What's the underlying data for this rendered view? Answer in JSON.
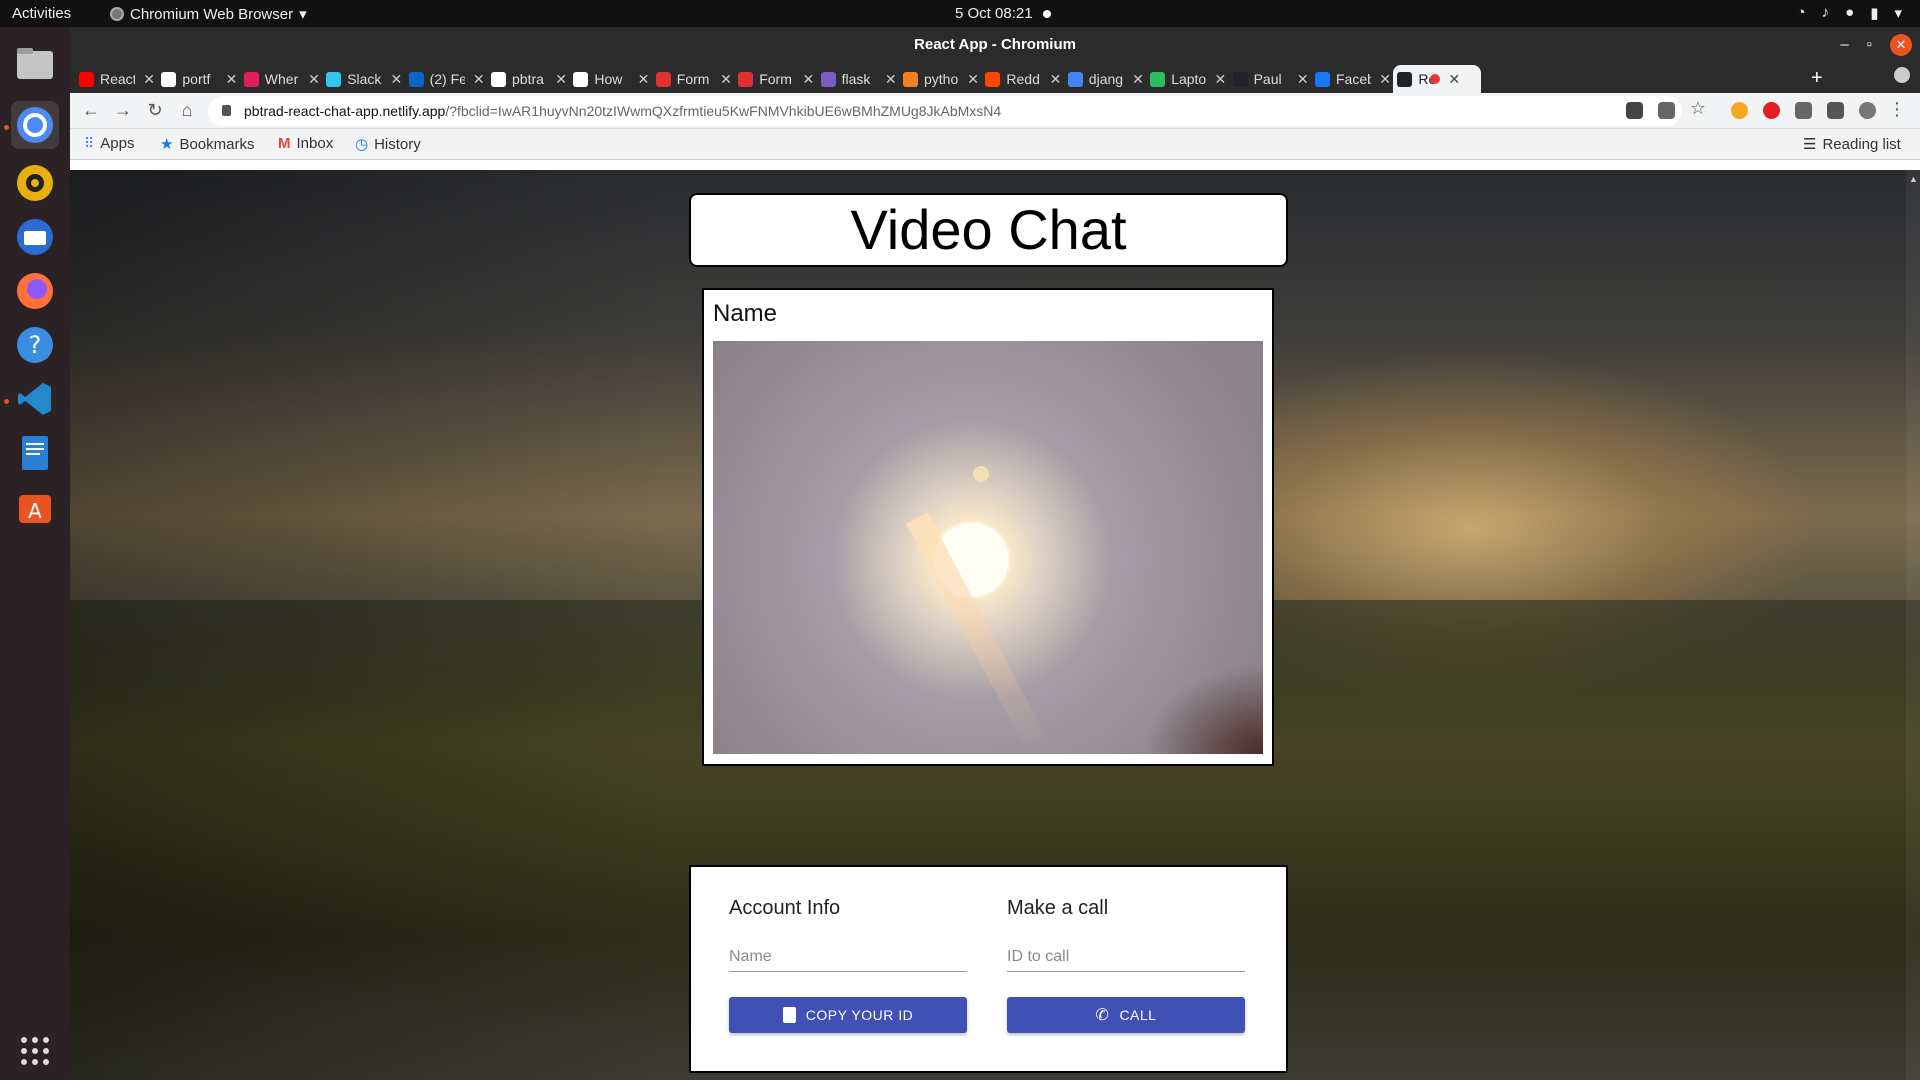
{
  "system": {
    "activities": "Activities",
    "app_name": "Chromium Web Browser",
    "clock": "5 Oct  08:21"
  },
  "window": {
    "title": "React App - Chromium"
  },
  "tabs": [
    {
      "label": "React",
      "color": "#ff0000"
    },
    {
      "label": "portf",
      "color": "#ffffff"
    },
    {
      "label": "Wher",
      "color": "#e01e5a"
    },
    {
      "label": "Slack",
      "color": "#36c5f0"
    },
    {
      "label": "(2) Fe",
      "color": "#0a66c2"
    },
    {
      "label": "pbtra",
      "color": "#ffffff"
    },
    {
      "label": "How",
      "color": "#ffffff"
    },
    {
      "label": "Form",
      "color": "#e03131"
    },
    {
      "label": "Form",
      "color": "#e03131"
    },
    {
      "label": "flask",
      "color": "#7a5cc4"
    },
    {
      "label": "pytho",
      "color": "#f48024"
    },
    {
      "label": "Redd",
      "color": "#ff4500"
    },
    {
      "label": "djang",
      "color": "#4285f4"
    },
    {
      "label": "Lapto",
      "color": "#2dbe60"
    },
    {
      "label": "Paul",
      "color": "#20232a"
    },
    {
      "label": "Faceb",
      "color": "#1877f2"
    },
    {
      "label": "Re",
      "color": "#20232a",
      "active": true
    }
  ],
  "address_bar": {
    "host": "pbtrad-react-chat-app.netlify.app",
    "path": "/?fbclid=IwAR1huyvNn20tzIWwmQXzfrmtieu5KwFNMVhkibUE6wBMhZMUg8JkAbMxsN4"
  },
  "bookmarks": {
    "apps": "Apps",
    "bookmarks": "Bookmarks",
    "inbox": "Inbox",
    "history": "History",
    "reading_list": "Reading list"
  },
  "page": {
    "title": "Video Chat",
    "video_name": "Name",
    "account_heading": "Account Info",
    "name_placeholder": "Name",
    "copy_button": "COPY YOUR ID",
    "call_heading": "Make a call",
    "id_placeholder": "ID to call",
    "call_button": "CALL"
  },
  "colors": {
    "button": "#3f51b5",
    "ubuntu_orange": "#e95420"
  }
}
